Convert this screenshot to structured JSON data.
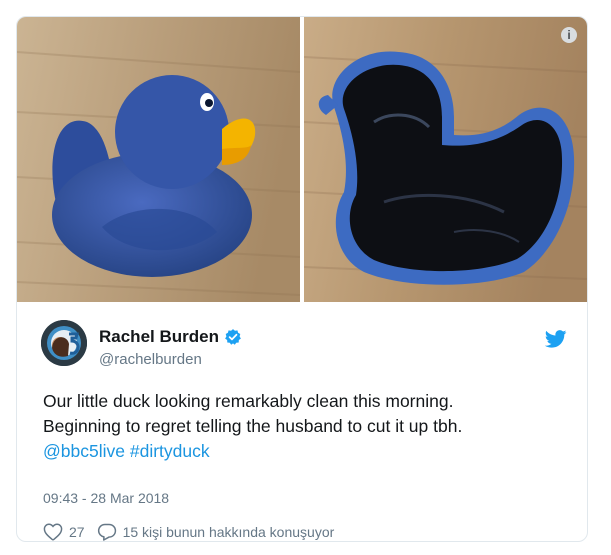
{
  "tweet": {
    "author": {
      "name": "Rachel Burden",
      "handle": "@rachelburden",
      "verified": true
    },
    "text_lines": [
      "Our little duck looking remarkably clean this morning.",
      "Beginning to regret telling the husband to cut it up tbh."
    ],
    "mentions": {
      "mention": "@bbc5live",
      "hashtag": "#dirtyduck"
    },
    "timestamp": "09:43 - 28 Mar 2018",
    "likes": "27",
    "discussion": "15 kişi bunun hakkında konuşuyor"
  },
  "info_icon": "i",
  "colors": {
    "link": "#1b95e0",
    "verified": "#1da1f2",
    "twitter_blue": "#1da1f2",
    "muted": "#657786",
    "duck_blue": "#2f4f9e",
    "duck_beak": "#f4b400"
  },
  "icons": [
    "info-icon",
    "verified-badge-icon",
    "twitter-bird-icon",
    "heart-icon",
    "reply-bubble-icon"
  ]
}
